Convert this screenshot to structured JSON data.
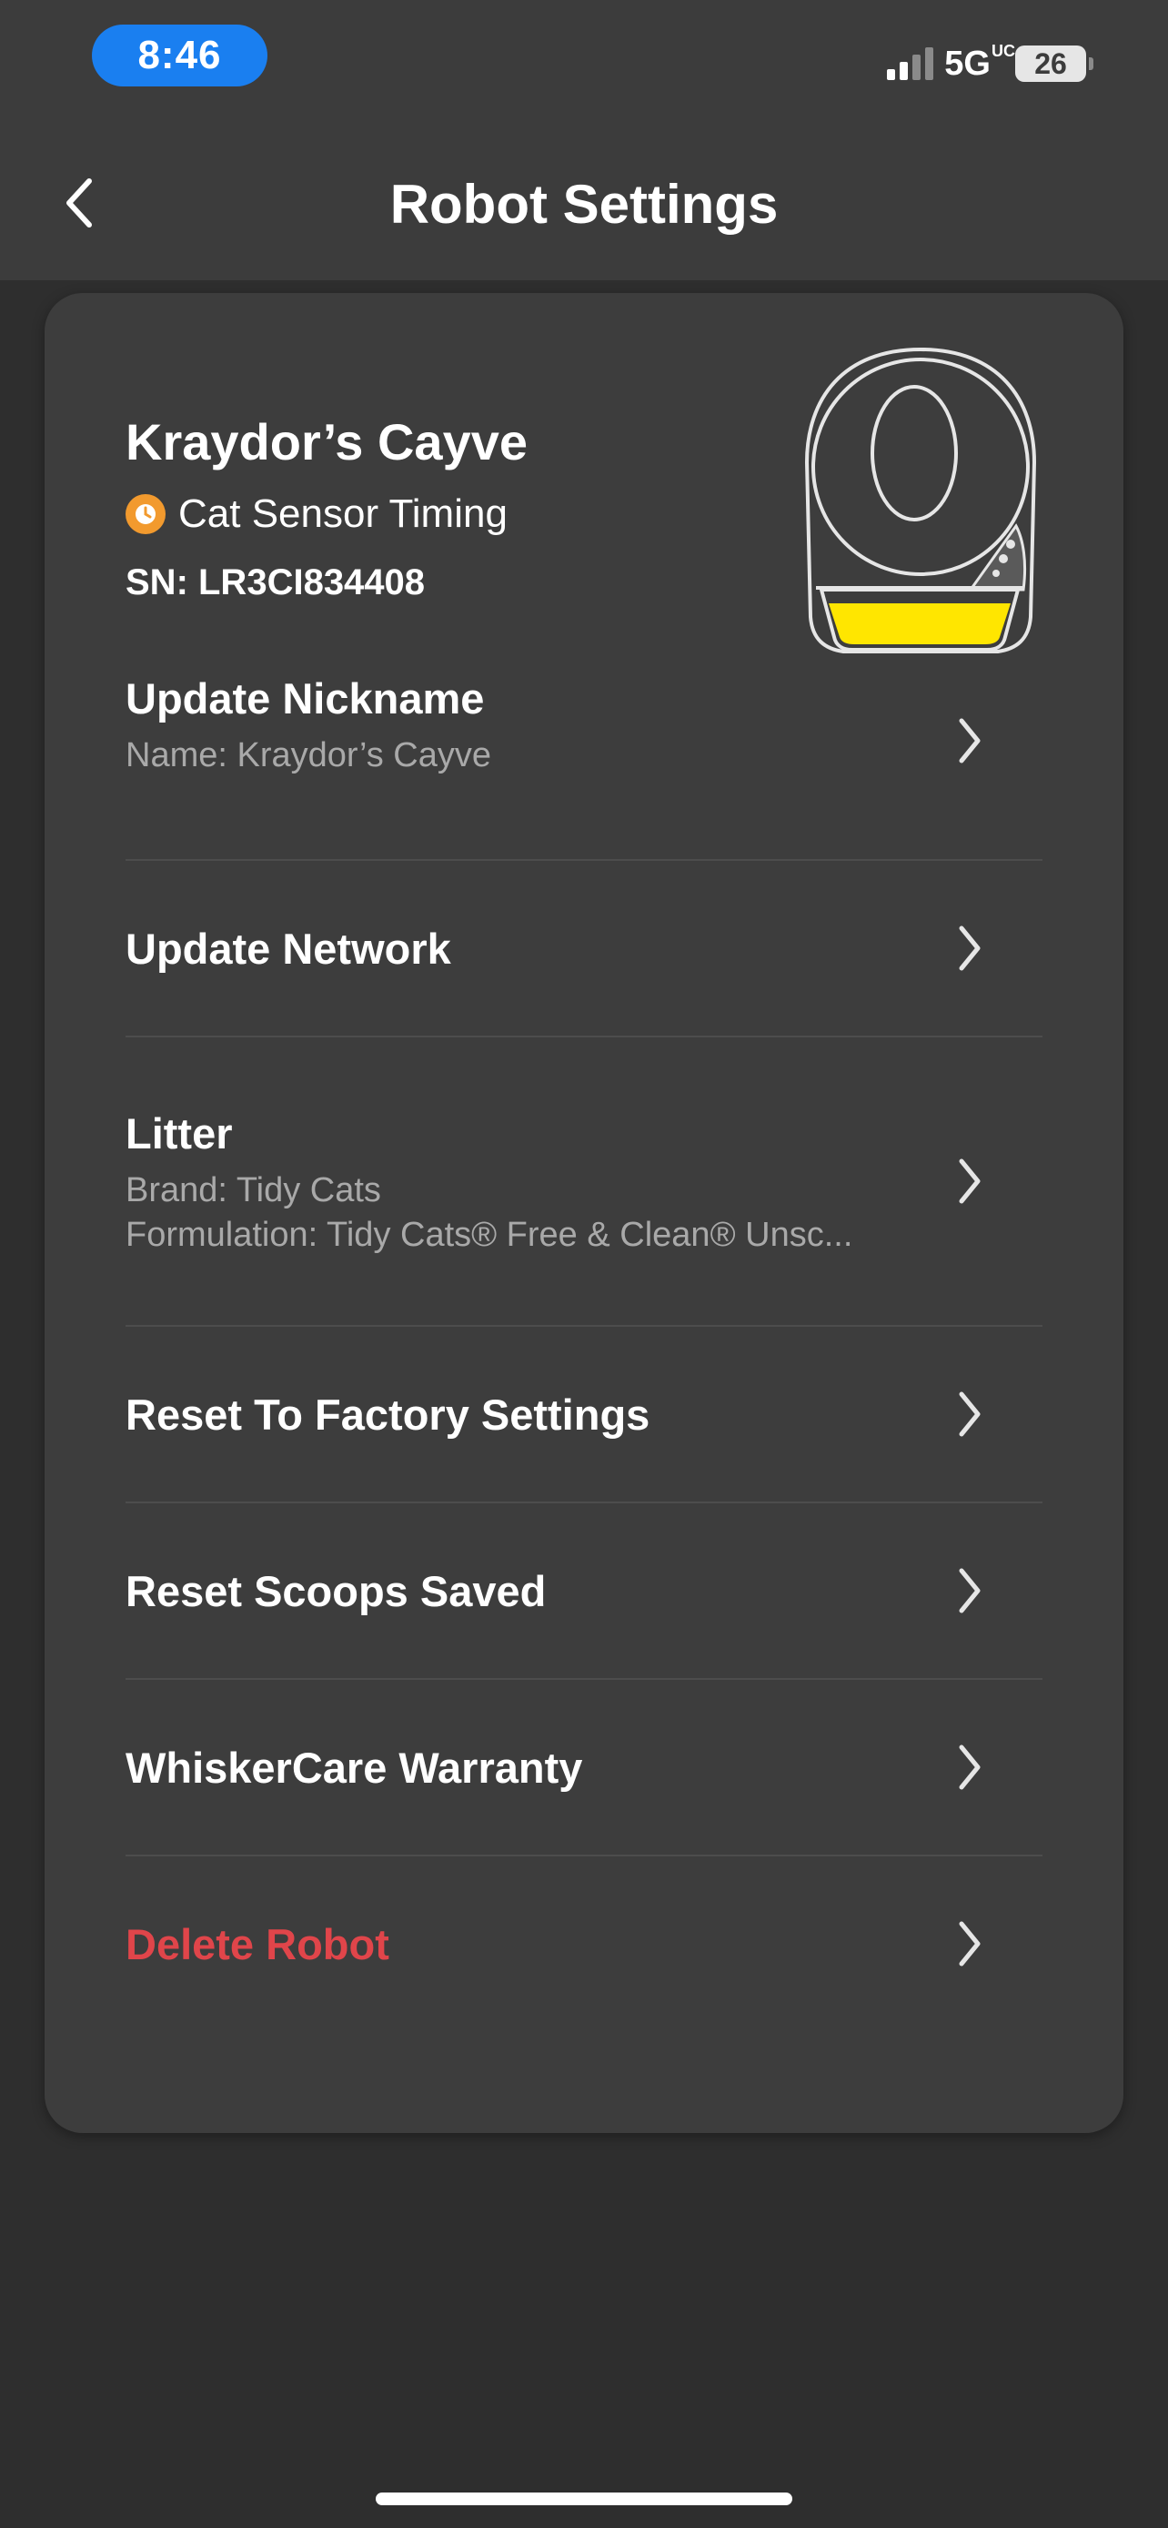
{
  "status_bar": {
    "time": "8:46",
    "network": "5G",
    "network_suffix": "UC",
    "battery": "26"
  },
  "header": {
    "title": "Robot Settings",
    "back_icon": "chevron-left-icon"
  },
  "robot": {
    "name": "Kraydor’s Cayve",
    "status": "Cat Sensor Timing",
    "status_icon": "clock-icon",
    "status_icon_color": "#f29a2e",
    "serial": "SN: LR3CI834408",
    "drawer_fill_color": "#ffe600"
  },
  "settings": [
    {
      "label": "Update Nickname",
      "sub": [
        "Name: Kraydor’s Cayve"
      ]
    },
    {
      "label": "Update Network",
      "sub": []
    },
    {
      "label": "Litter",
      "sub": [
        "Brand: Tidy Cats",
        "Formulation: Tidy Cats® Free & Clean® Unsc..."
      ]
    },
    {
      "label": "Reset To Factory Settings",
      "sub": []
    },
    {
      "label": "Reset Scoops Saved",
      "sub": []
    },
    {
      "label": "WhiskerCare Warranty",
      "sub": []
    },
    {
      "label": "Delete Robot",
      "sub": [],
      "danger": true
    }
  ],
  "colors": {
    "background": "#2e2e2e",
    "header": "#3c3c3c",
    "card": "#3d3d3d",
    "time_pill": "#1a7ff0",
    "danger": "#e0454a",
    "subtext": "#a9a9a9"
  }
}
